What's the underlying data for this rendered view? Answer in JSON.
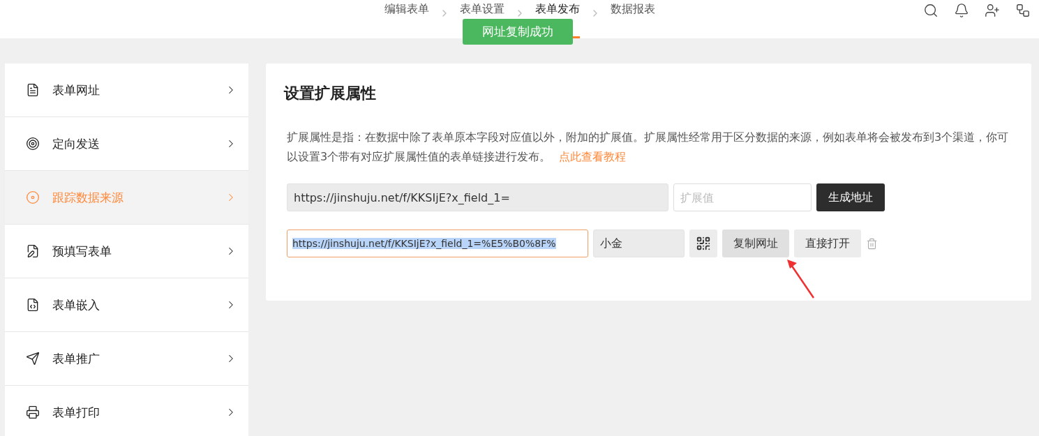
{
  "nav": {
    "steps": [
      {
        "label": "编辑表单",
        "selected": false
      },
      {
        "label": "表单设置",
        "selected": false
      },
      {
        "label": "表单发布",
        "selected": true
      },
      {
        "label": "数据报表",
        "selected": false
      }
    ]
  },
  "toast": {
    "text": "网址复制成功"
  },
  "sidebar": {
    "items": [
      {
        "label": "表单网址",
        "selected": false
      },
      {
        "label": "定向发送",
        "selected": false
      },
      {
        "label": "跟踪数据来源",
        "selected": true
      },
      {
        "label": "预填写表单",
        "selected": false
      },
      {
        "label": "表单嵌入",
        "selected": false
      },
      {
        "label": "表单推广",
        "selected": false
      },
      {
        "label": "表单打印",
        "selected": false
      }
    ]
  },
  "panel": {
    "title": "设置扩展属性",
    "description": "扩展属性是指：在数据中除了表单原本字段对应值以外，附加的扩展值。扩展属性经常用于区分数据的来源，例如表单将会被发布到3个渠道，你可以设置3个带有对应扩展属性值的表单链接进行发布。",
    "tutorial_link": "点此查看教程",
    "base_url": "https://jinshuju.net/f/KKSIjE?x_field_1=",
    "value_field": {
      "placeholder": "扩展值"
    },
    "generate_button": "生成地址",
    "links": [
      {
        "url": "https://jinshuju.net/f/KKSIjE?x_field_1=%E5%B0%8F%",
        "value": "小金",
        "text_selected": true,
        "copy_button": "复制网址",
        "open_button": "直接打开"
      }
    ]
  }
}
